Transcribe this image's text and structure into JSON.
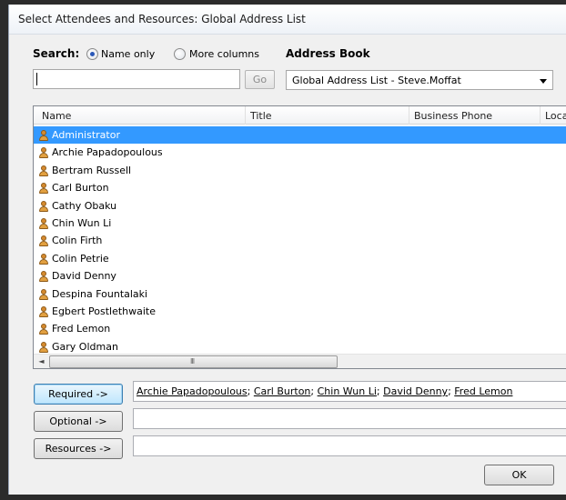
{
  "dialog": {
    "title": "Select Attendees and Resources: Global Address List"
  },
  "search": {
    "label": "Search:",
    "option_name_only": "Name only",
    "option_more_columns": "More columns",
    "selected_option": "Name only",
    "value": "",
    "go_label": "Go"
  },
  "address_book": {
    "label": "Address Book",
    "selected": "Global Address List - Steve.Moffat"
  },
  "list": {
    "columns": [
      "Name",
      "Title",
      "Business Phone",
      "Loca"
    ],
    "rows": [
      {
        "name": "Administrator",
        "selected": true
      },
      {
        "name": "Archie Papadopoulous",
        "selected": false
      },
      {
        "name": "Bertram Russell",
        "selected": false
      },
      {
        "name": "Carl Burton",
        "selected": false
      },
      {
        "name": "Cathy Obaku",
        "selected": false
      },
      {
        "name": "Chin Wun Li",
        "selected": false
      },
      {
        "name": "Colin Firth",
        "selected": false
      },
      {
        "name": "Colin Petrie",
        "selected": false
      },
      {
        "name": "David Denny",
        "selected": false
      },
      {
        "name": "Despina Fountalaki",
        "selected": false
      },
      {
        "name": "Egbert Postlethwaite",
        "selected": false
      },
      {
        "name": "Fred Lemon",
        "selected": false
      },
      {
        "name": "Gary Oldman",
        "selected": false
      }
    ],
    "scroll_left_glyph": "◄",
    "scroll_grip": "III",
    "row_icon": "user-icon",
    "selection_color": "#3399ff"
  },
  "attendees": {
    "required_label": "Required ->",
    "optional_label": "Optional ->",
    "resources_label": "Resources ->",
    "required_entries": [
      "Archie Papadopoulous",
      "Carl Burton",
      "Chin Wun Li",
      "David Denny",
      "Fred Lemon"
    ],
    "separator": "; ",
    "optional_value": "",
    "resources_value": ""
  },
  "footer": {
    "ok_label": "OK"
  }
}
